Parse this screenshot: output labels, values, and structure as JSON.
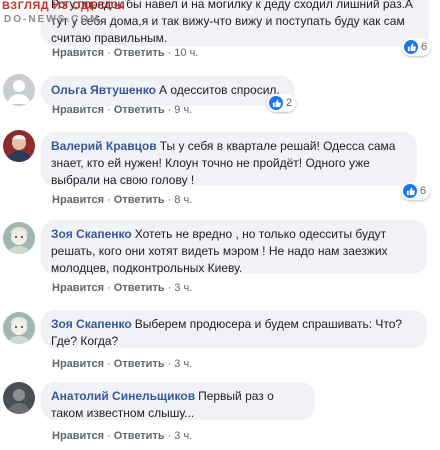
{
  "watermark": {
    "line1": "ВЗГЛЯД ИЗ ОДЕССЫ",
    "line2": "DO-NEWS.COM"
  },
  "actions": {
    "like": "Нравится",
    "reply": "Ответить",
    "dot": "·"
  },
  "comments": [
    {
      "author": "",
      "text": "Рогу,порядок бы навел и на могилку к деду сходил лишний раз.А тут у себя дома,я и так вижу-что вижу и поступать буду как сам считаю правильным.",
      "time": "10 ч.",
      "reactions": "6"
    },
    {
      "author": "Ольга Явтушенко",
      "text": "А одесситов спросил.",
      "time": "9 ч.",
      "reactions": "2"
    },
    {
      "author": "Валерий Кравцов",
      "text": "Ты у себя в квартале решай! Одесса сама знает, кто ей нужен! Клоун точно не пройдёт! Одного уже выбрали на свою голову !",
      "time": "8 ч.",
      "reactions": "6"
    },
    {
      "author": "Зоя Скапенко",
      "text": "Хотеть не вредно , но только одесситы будут решать, кого они хотят видеть мэром !  Не надо нам заезжих молодцев, подконтрольных Киеву.",
      "time": "3 ч.",
      "reactions": ""
    },
    {
      "author": "Зоя Скапенко",
      "text": "Выберем продюсера и будем спрашивать: Что? Где? Когда?",
      "time": "3 ч.",
      "reactions": ""
    },
    {
      "author": "Анатолий Синельщиков",
      "text": "Первый раз о таком известном слышу...",
      "time": "3 ч.",
      "reactions": ""
    }
  ],
  "colors": {
    "author": "#385898",
    "bubble": "#f0f2f5",
    "like": "#1877f2",
    "watermark": "#c9302c"
  }
}
